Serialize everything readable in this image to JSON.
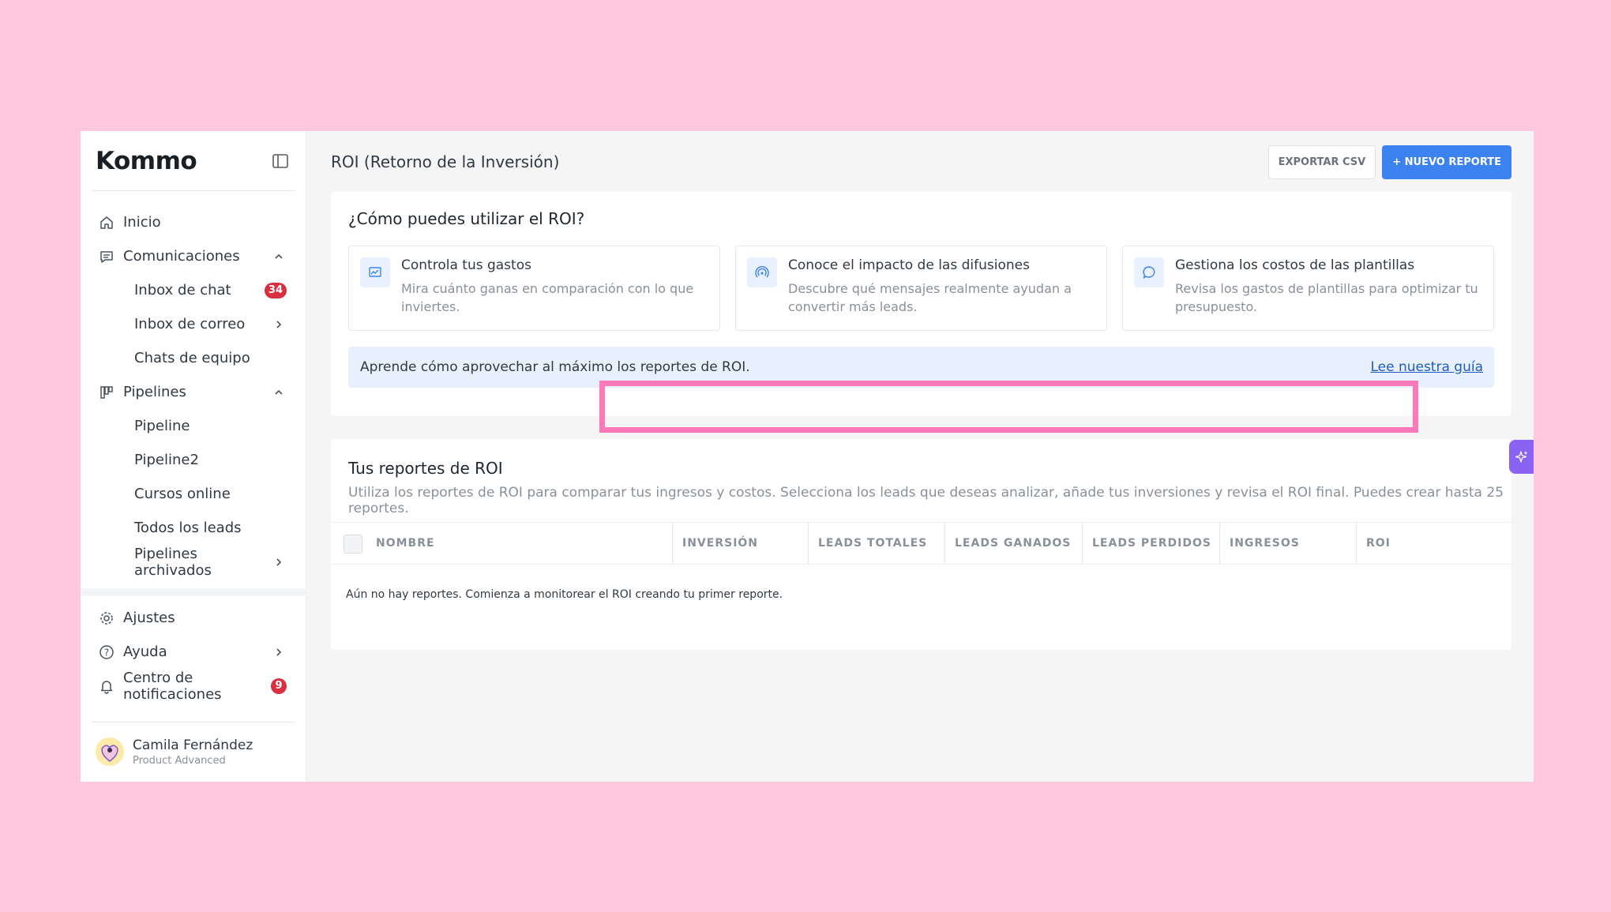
{
  "app": {
    "logo": "Kommo"
  },
  "sidebar": {
    "items": [
      {
        "label": "Inicio",
        "icon": "home-icon"
      },
      {
        "label": "Comunicaciones",
        "icon": "chat-icon"
      },
      {
        "label": "Inbox de chat",
        "badge": "34"
      },
      {
        "label": "Inbox de correo"
      },
      {
        "label": "Chats de equipo"
      },
      {
        "label": "Pipelines",
        "icon": "pipeline-icon"
      },
      {
        "label": "Pipeline"
      },
      {
        "label": "Pipeline2"
      },
      {
        "label": "Cursos online"
      },
      {
        "label": "Todos los leads"
      },
      {
        "label": "Pipelines archivados"
      }
    ],
    "bottom": [
      {
        "label": "Ajustes",
        "icon": "gear-icon"
      },
      {
        "label": "Ayuda",
        "icon": "help-icon"
      },
      {
        "label": "Centro de notificaciones",
        "icon": "bell-icon",
        "badge": "9"
      }
    ],
    "user": {
      "name": "Camila Fernández",
      "role": "Product Advanced"
    }
  },
  "header": {
    "title": "ROI (Retorno de la Inversión)",
    "export_label": "EXPORTAR CSV",
    "new_report_label": "+ NUEVO REPORTE"
  },
  "how": {
    "title": "¿Cómo puedes utilizar el ROI?",
    "tips": [
      {
        "title": "Controla tus gastos",
        "desc": "Mira cuánto ganas en comparación con lo que inviertes.",
        "icon": "chart-icon"
      },
      {
        "title": "Conoce el impacto de las difusiones",
        "desc": "Descubre qué mensajes realmente ayudan a convertir más leads.",
        "icon": "broadcast-icon"
      },
      {
        "title": "Gestiona los costos de las plantillas",
        "desc": "Revisa los gastos de plantillas para optimizar tu presupuesto.",
        "icon": "message-icon"
      }
    ],
    "guide_text": "Aprende cómo aprovechar al máximo los reportes de ROI.",
    "guide_link": "Lee nuestra guía"
  },
  "reports": {
    "title": "Tus reportes de ROI",
    "desc": "Utiliza los reportes de ROI para comparar tus ingresos y costos. Selecciona los leads que deseas analizar, añade tus inversiones y revisa el ROI final. Puedes crear hasta 25 reportes.",
    "columns": [
      "NOMBRE",
      "INVERSIÓN",
      "LEADS TOTALES",
      "LEADS GANADOS",
      "LEADS PERDIDOS",
      "INGRESOS",
      "ROI"
    ],
    "empty": "Aún no hay reportes. Comienza a monitorear el ROI creando tu primer reporte."
  },
  "colors": {
    "accent": "#3c82f0",
    "badge": "#d9303f",
    "highlight": "#ff79b8",
    "background": "#ffc8de"
  }
}
